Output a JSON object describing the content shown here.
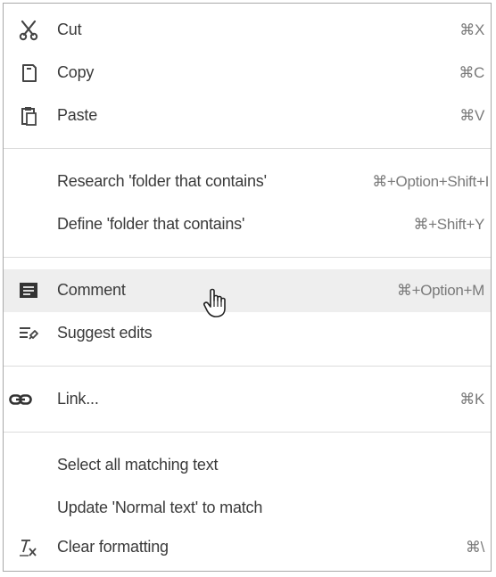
{
  "menu": {
    "items": [
      {
        "label": "Cut",
        "shortcut": "⌘X",
        "icon": "scissors-icon"
      },
      {
        "label": "Copy",
        "shortcut": "⌘C",
        "icon": "copy-icon"
      },
      {
        "label": "Paste",
        "shortcut": "⌘V",
        "icon": "paste-icon"
      },
      {
        "label": "Research 'folder that contains'",
        "shortcut": "⌘+Option+Shift+I"
      },
      {
        "label": "Define 'folder that contains'",
        "shortcut": "⌘+Shift+Y"
      },
      {
        "label": "Comment",
        "shortcut": "⌘+Option+M",
        "icon": "comment-icon"
      },
      {
        "label": "Suggest edits",
        "icon": "suggest-edits-icon"
      },
      {
        "label": "Link...",
        "shortcut": "⌘K",
        "icon": "link-icon"
      },
      {
        "label": "Select all matching text"
      },
      {
        "label": "Update 'Normal text' to match"
      },
      {
        "label": "Clear formatting",
        "shortcut": "⌘\\",
        "icon": "clear-formatting-icon"
      }
    ],
    "hovered_item": "Comment"
  },
  "colors": {
    "text": "#3a3a3a",
    "shortcut": "#7a7a7a",
    "hover_background": "#eeeeee",
    "separator": "#dcdcdc",
    "border": "#a8a8a8"
  }
}
